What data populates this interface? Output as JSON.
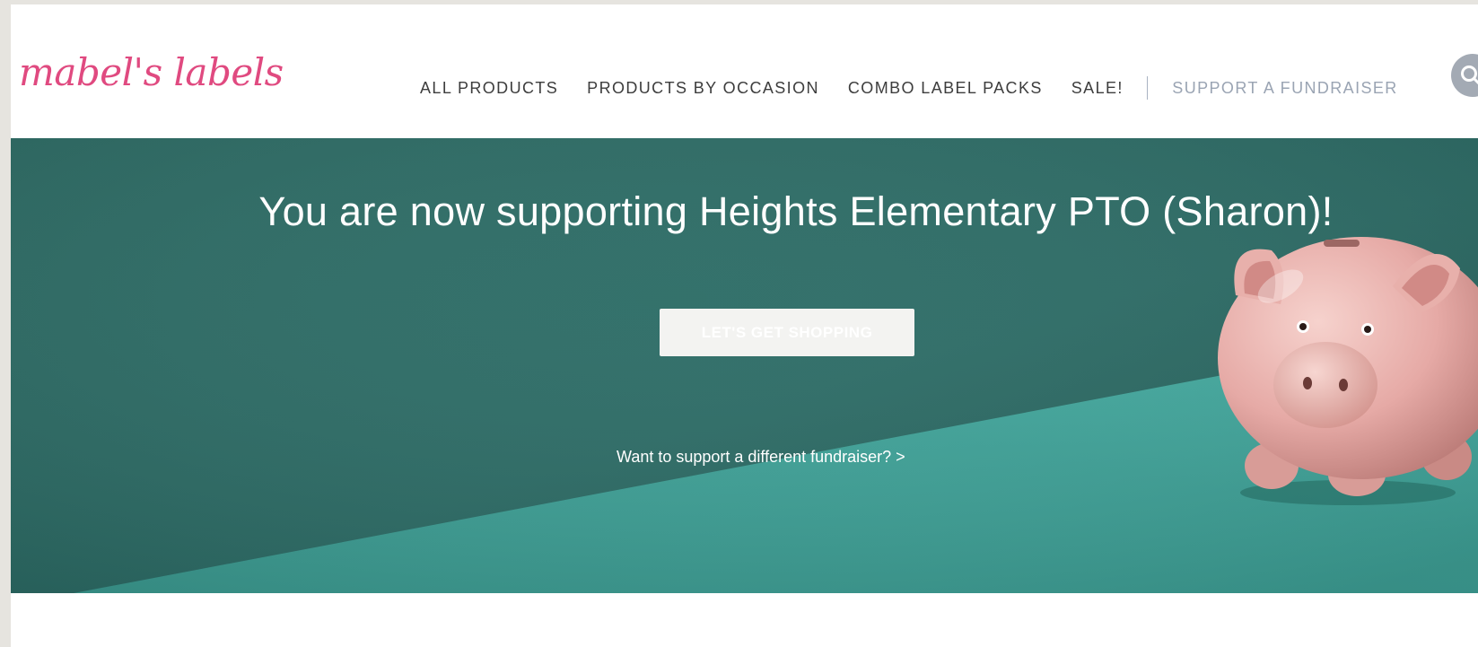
{
  "brand": {
    "logo_text": "mabel's labels",
    "color": "#e04a80"
  },
  "nav": {
    "items": [
      {
        "label": "ALL PRODUCTS"
      },
      {
        "label": "PRODUCTS BY OCCASION"
      },
      {
        "label": "COMBO LABEL PACKS"
      },
      {
        "label": "SALE!"
      }
    ],
    "fundraiser_label": "SUPPORT A FUNDRAISER",
    "search_icon": "search-icon"
  },
  "hero": {
    "title": "You are now supporting Heights Elementary PTO (Sharon)!",
    "button_label": "LET'S GET SHOPPING",
    "link_text": "Want to support a different fundraiser?  >",
    "image": "piggy-bank-illustration",
    "colors": {
      "background_dark": "#2e6f68",
      "background_light": "#44a89e",
      "pig": "#e8b3b0"
    }
  }
}
